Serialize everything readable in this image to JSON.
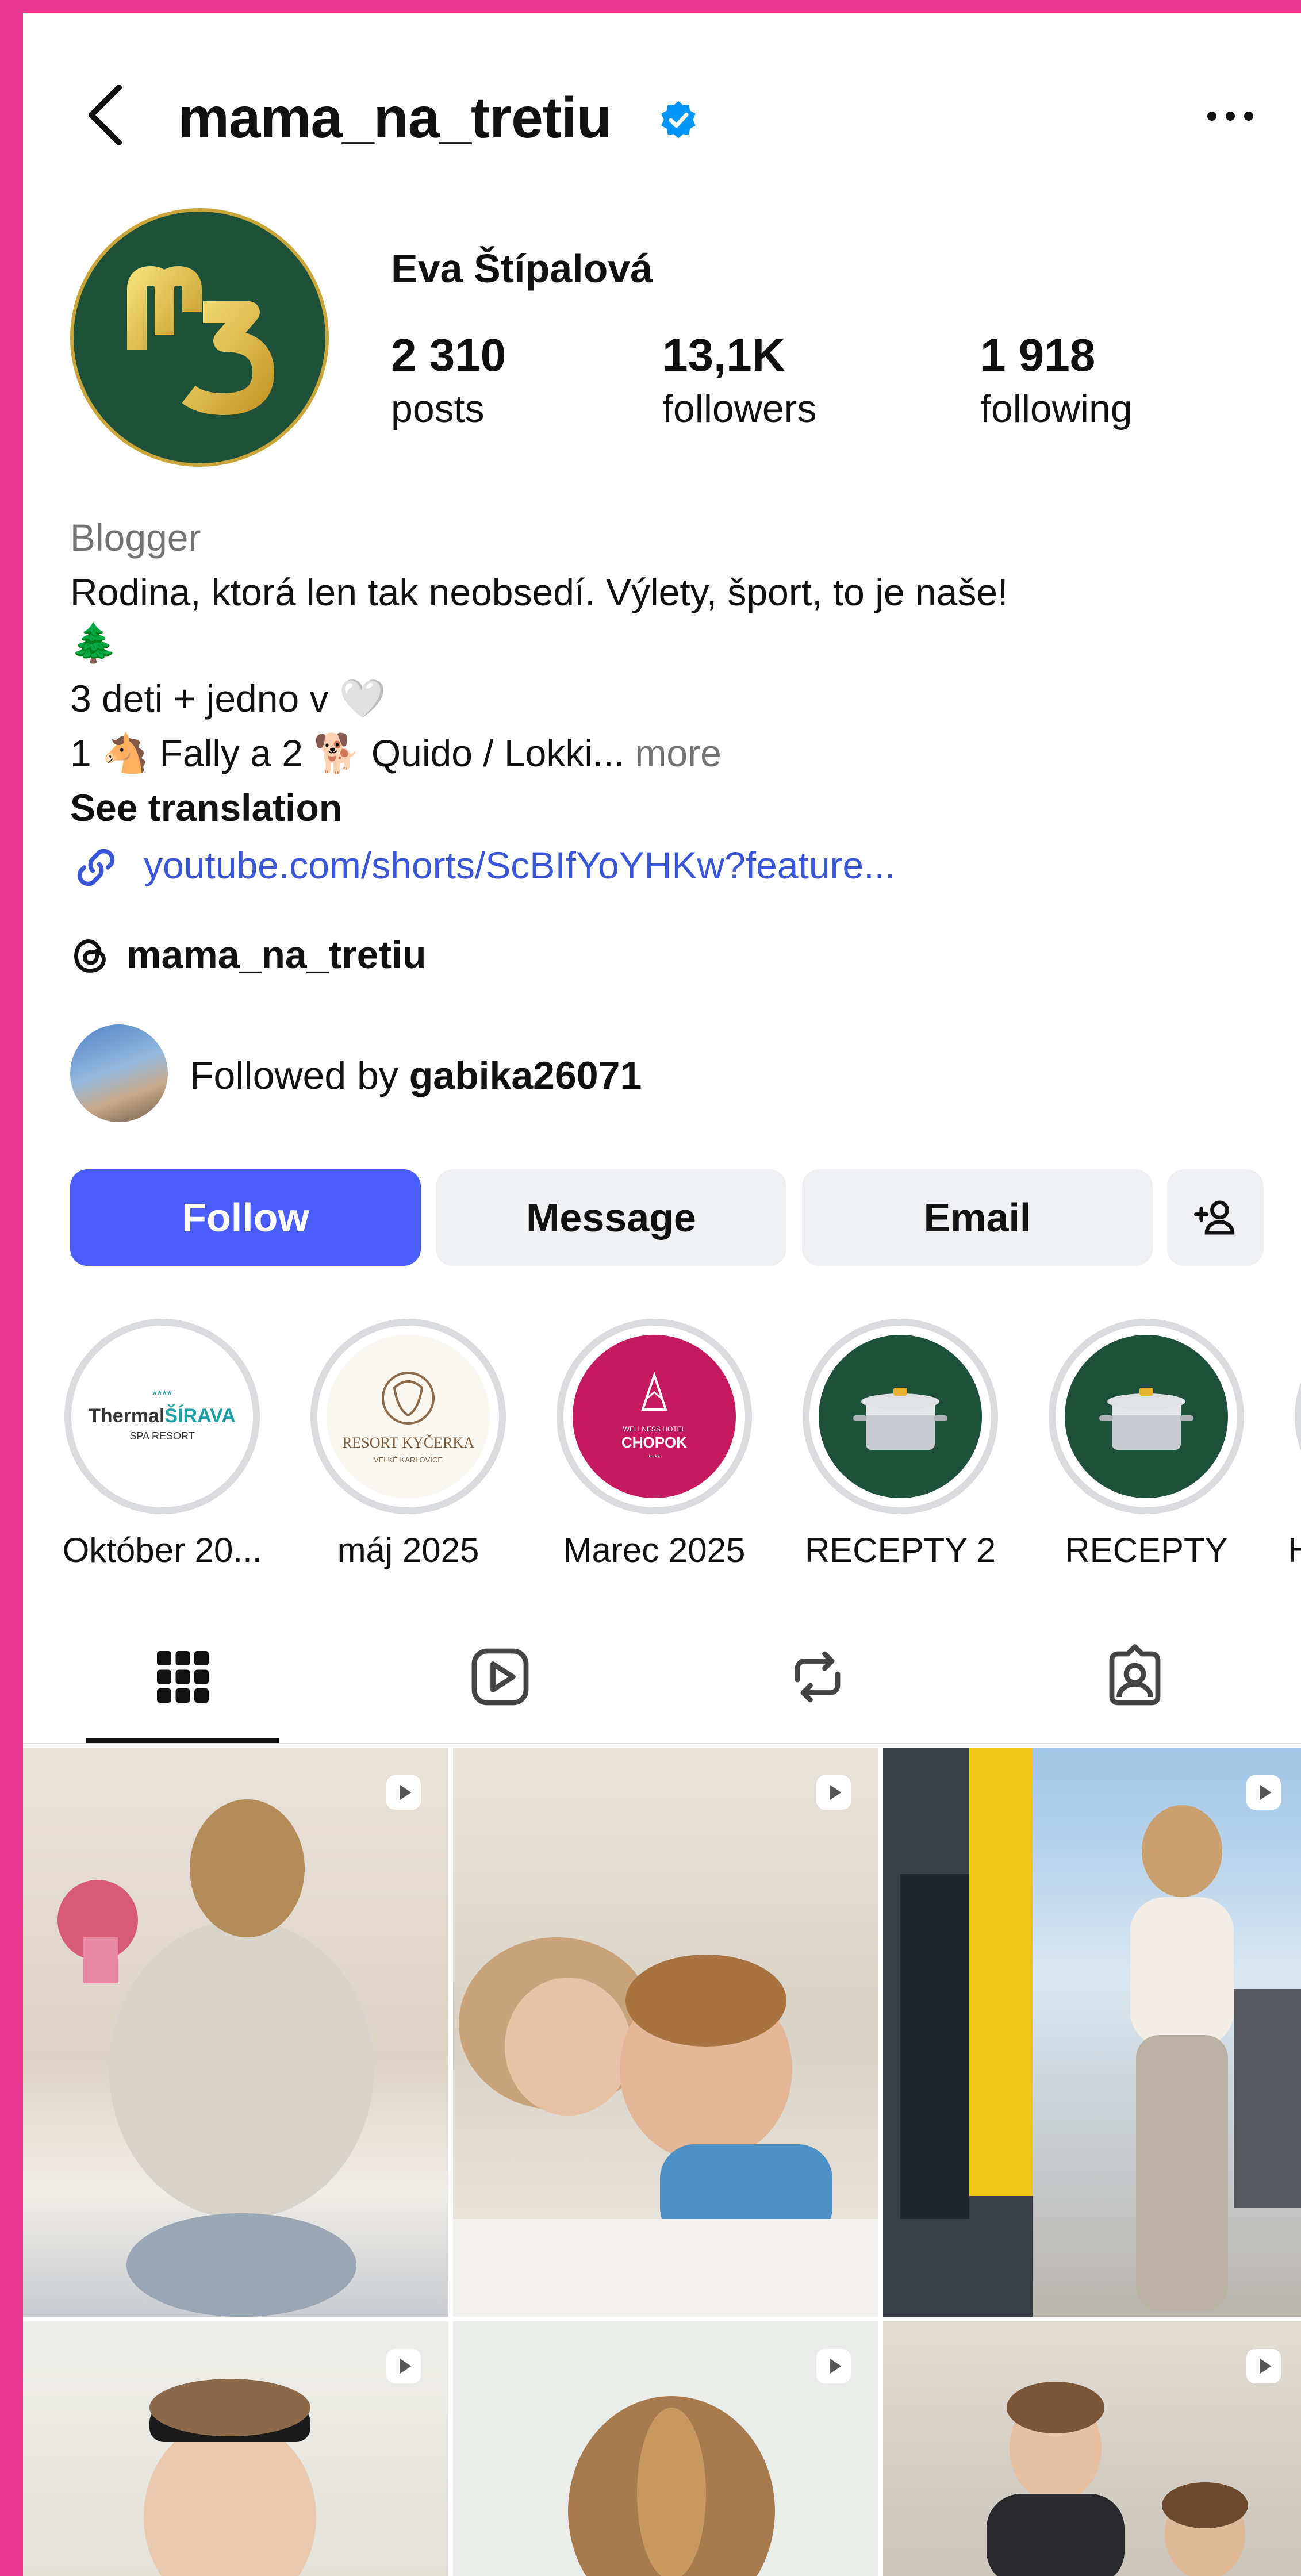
{
  "profile": {
    "username": "mama_na_tretiu",
    "display_name": "Eva Štípalová",
    "avatar_text": "m3",
    "stats": {
      "posts": "2 310",
      "posts_label": "posts",
      "followers": "13,1K",
      "followers_label": "followers",
      "following": "1 918",
      "following_label": "following"
    },
    "category": "Blogger",
    "bio_line1": "Rodina, ktorá len tak neobsedí. Výlety, šport, to je naše!",
    "bio_line2": "🌲",
    "bio_line3": "3 deti + jedno v 🤍",
    "bio_line4": "1 🐴 Fally a 2 🐕 Quido / Lokki...",
    "more": "more",
    "see_translation": "See translation",
    "link": "youtube.com/shorts/ScBIfYoYHKw?feature...",
    "threads_handle": "mama_na_tretiu",
    "followed_by_prefix": "Followed by",
    "followed_by_user": "gabika26071"
  },
  "buttons": {
    "follow": "Follow",
    "message": "Message",
    "email": "Email"
  },
  "highlights": [
    {
      "label": "Október 20...",
      "logo_line1": "****",
      "logo_line2a": "Thermal",
      "logo_line2b": "ŠÍRAVA",
      "logo_line3": "SPA RESORT"
    },
    {
      "label": "máj 2025",
      "logo_line1": "RESORT KYČERKA",
      "logo_line2": "VELKÉ KARLOVICE"
    },
    {
      "label": "Marec 2025",
      "logo_line1": "WELLNESS HOTEL",
      "logo_line2": "CHOPOK",
      "logo_line3": "****"
    },
    {
      "label": "RECEPTY 2"
    },
    {
      "label": "RECEPTY"
    },
    {
      "label": "H"
    }
  ],
  "tabs": [
    {
      "name": "grid-icon"
    },
    {
      "name": "reels-icon"
    },
    {
      "name": "reposts-icon"
    },
    {
      "name": "tagged-icon"
    }
  ],
  "colors": {
    "follow_button": "#4a5dfb",
    "link": "#3a55d6",
    "verified": "#0095f6",
    "avatar_bg": "#1f5039",
    "avatar_gold": "#d4b24a",
    "page_frame": "#e8388f"
  }
}
